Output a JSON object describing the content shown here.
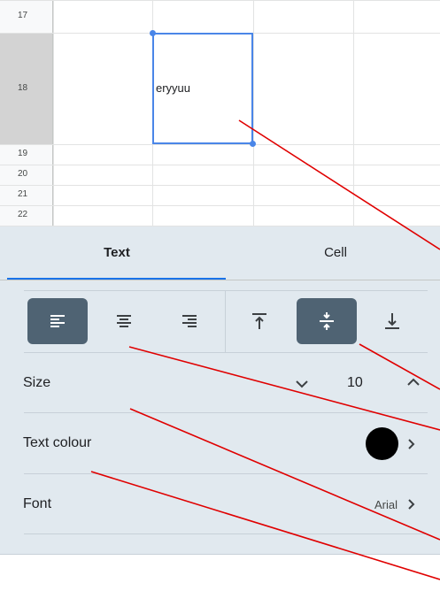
{
  "sheet": {
    "rows": [
      {
        "number": "17"
      },
      {
        "number": "18"
      },
      {
        "number": "19"
      },
      {
        "number": "20"
      },
      {
        "number": "21"
      },
      {
        "number": "22"
      }
    ],
    "selected_cell_text": "eryyuu"
  },
  "panel": {
    "tabs": [
      {
        "label": "Text",
        "active": true
      },
      {
        "label": "Cell",
        "active": false
      }
    ],
    "horizontal_align": {
      "options": [
        "align-left-icon",
        "align-center-icon",
        "align-right-icon"
      ],
      "selected": "align-left-icon"
    },
    "vertical_align": {
      "options": [
        "align-top-icon",
        "align-middle-icon",
        "align-bottom-icon"
      ],
      "selected": "align-middle-icon"
    },
    "size": {
      "label": "Size",
      "value": "10"
    },
    "text_colour": {
      "label": "Text colour",
      "value_color": "#000000"
    },
    "font": {
      "label": "Font",
      "value": "Arial"
    }
  },
  "colors": {
    "accent": "#1a73e8",
    "selection_border": "#4a86e8",
    "panel_bg": "#e1e9ef",
    "active_button": "#4f6373",
    "annotation": "#e00000"
  }
}
